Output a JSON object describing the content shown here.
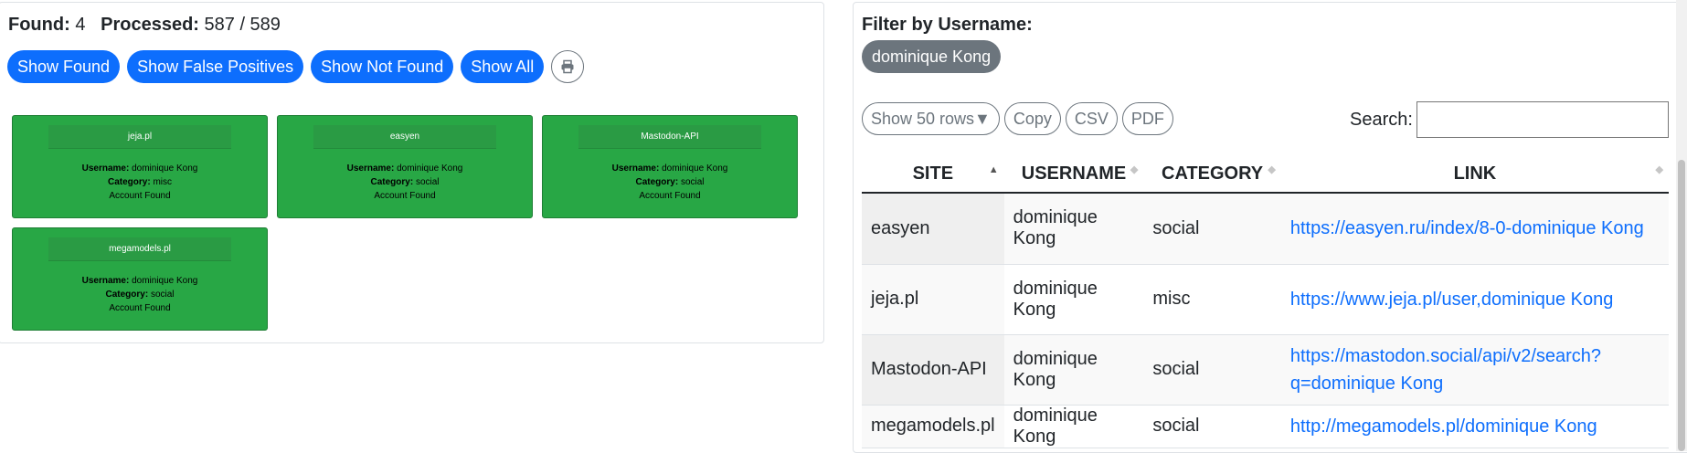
{
  "stats": {
    "found_label": "Found:",
    "found_value": "4",
    "processed_label": "Processed:",
    "processed_value": "587 / 589"
  },
  "filters": {
    "show_found": "Show Found",
    "show_false_positives": "Show False Positives",
    "show_not_found": "Show Not Found",
    "show_all": "Show All",
    "print_icon": "printer-icon"
  },
  "cards": [
    {
      "site": "jeja.pl",
      "username_label": "Username:",
      "username": "dominique Kong",
      "category_label": "Category:",
      "category": "misc",
      "status": "Account Found"
    },
    {
      "site": "easyen",
      "username_label": "Username:",
      "username": "dominique Kong",
      "category_label": "Category:",
      "category": "social",
      "status": "Account Found"
    },
    {
      "site": "Mastodon-API",
      "username_label": "Username:",
      "username": "dominique Kong",
      "category_label": "Category:",
      "category": "social",
      "status": "Account Found"
    },
    {
      "site": "megamodels.pl",
      "username_label": "Username:",
      "username": "dominique Kong",
      "category_label": "Category:",
      "category": "social",
      "status": "Account Found"
    }
  ],
  "filter_panel": {
    "title": "Filter by Username:",
    "chip": "dominique Kong"
  },
  "table_tools": {
    "rows_button": "Show 50 rows▼",
    "copy": "Copy",
    "csv": "CSV",
    "pdf": "PDF",
    "search_label": "Search:",
    "search_value": ""
  },
  "table": {
    "headers": [
      "SITE",
      "USERNAME",
      "CATEGORY",
      "LINK"
    ],
    "rows": [
      {
        "site": "easyen",
        "username": "dominique Kong",
        "category": "social",
        "link": "https://easyen.ru/index/8-0-dominique Kong"
      },
      {
        "site": "jeja.pl",
        "username": "dominique Kong",
        "category": "misc",
        "link": "https://www.jeja.pl/user,dominique Kong"
      },
      {
        "site": "Mastodon-API",
        "username": "dominique Kong",
        "category": "social",
        "link": "https://mastodon.social/api/v2/search?q=dominique Kong"
      },
      {
        "site": "megamodels.pl",
        "username": "dominique Kong",
        "category": "social",
        "link": "http://megamodels.pl/dominique Kong"
      }
    ]
  },
  "colors": {
    "primary": "#0d6efd",
    "found_card": "#28a745",
    "chip": "#6c757d"
  }
}
